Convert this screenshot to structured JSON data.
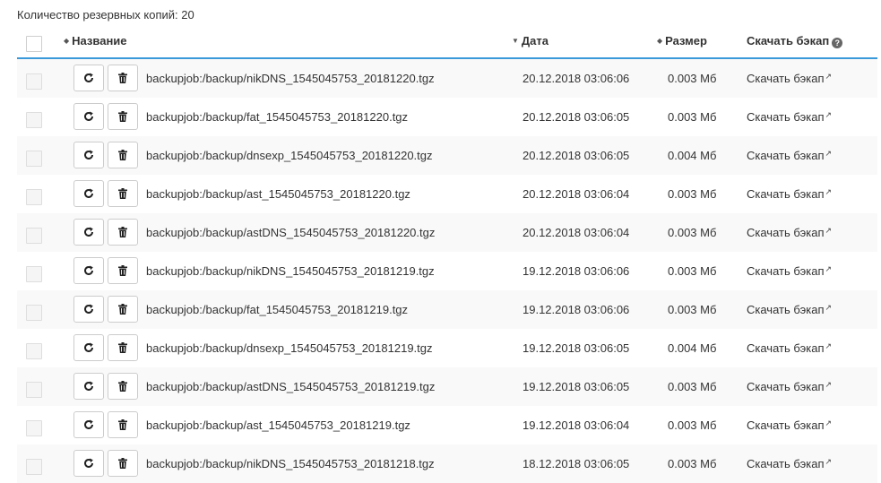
{
  "summary": {
    "label": "Количество резервных копий: 20"
  },
  "header": {
    "name": "Название",
    "date": "Дата",
    "size": "Размер",
    "download": "Скачать бэкап",
    "help_icon": "question-circle-icon"
  },
  "row_actions": {
    "restore_icon": "refresh-icon",
    "delete_icon": "trash-icon",
    "download_label": "Скачать бэкап",
    "external_icon": "external-link-icon"
  },
  "rows": [
    {
      "name": "backupjob:/backup/nikDNS_1545045753_20181220.tgz",
      "date": "20.12.2018 03:06:06",
      "size": "0.003 Мб",
      "download": "Скачать бэкап"
    },
    {
      "name": "backupjob:/backup/fat_1545045753_20181220.tgz",
      "date": "20.12.2018 03:06:05",
      "size": "0.003 Мб",
      "download": "Скачать бэкап"
    },
    {
      "name": "backupjob:/backup/dnsexp_1545045753_20181220.tgz",
      "date": "20.12.2018 03:06:05",
      "size": "0.004 Мб",
      "download": "Скачать бэкап"
    },
    {
      "name": "backupjob:/backup/ast_1545045753_20181220.tgz",
      "date": "20.12.2018 03:06:04",
      "size": "0.003 Мб",
      "download": "Скачать бэкап"
    },
    {
      "name": "backupjob:/backup/astDNS_1545045753_20181220.tgz",
      "date": "20.12.2018 03:06:04",
      "size": "0.003 Мб",
      "download": "Скачать бэкап"
    },
    {
      "name": "backupjob:/backup/nikDNS_1545045753_20181219.tgz",
      "date": "19.12.2018 03:06:06",
      "size": "0.003 Мб",
      "download": "Скачать бэкап"
    },
    {
      "name": "backupjob:/backup/fat_1545045753_20181219.tgz",
      "date": "19.12.2018 03:06:06",
      "size": "0.003 Мб",
      "download": "Скачать бэкап"
    },
    {
      "name": "backupjob:/backup/dnsexp_1545045753_20181219.tgz",
      "date": "19.12.2018 03:06:05",
      "size": "0.004 Мб",
      "download": "Скачать бэкап"
    },
    {
      "name": "backupjob:/backup/astDNS_1545045753_20181219.tgz",
      "date": "19.12.2018 03:06:05",
      "size": "0.003 Мб",
      "download": "Скачать бэкап"
    },
    {
      "name": "backupjob:/backup/ast_1545045753_20181219.tgz",
      "date": "19.12.2018 03:06:04",
      "size": "0.003 Мб",
      "download": "Скачать бэкап"
    },
    {
      "name": "backupjob:/backup/nikDNS_1545045753_20181218.tgz",
      "date": "18.12.2018 03:06:05",
      "size": "0.003 Мб",
      "download": "Скачать бэкап"
    }
  ]
}
